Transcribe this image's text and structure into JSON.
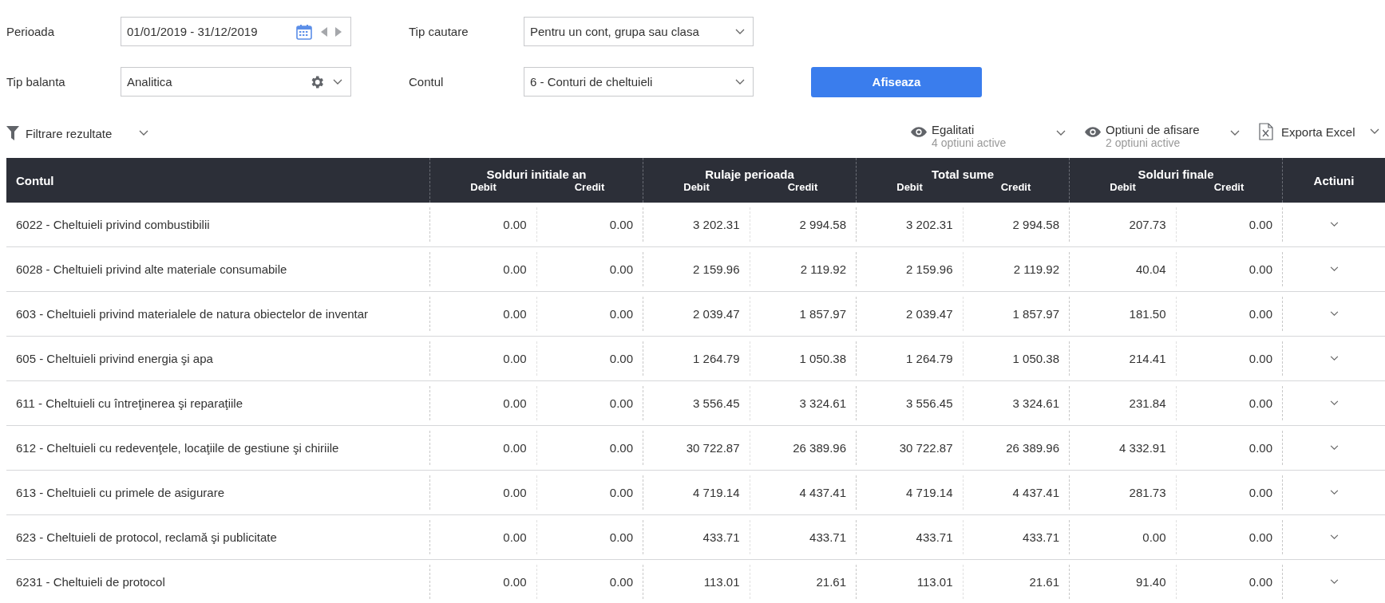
{
  "filters": [
    {
      "label": "Perioada",
      "kind": "date",
      "value": "01/01/2019 - 31/12/2019"
    },
    {
      "label": "Tip cautare",
      "kind": "select",
      "value": "Pentru un cont, grupa sau clasa"
    },
    {
      "label": "Tip balanta",
      "kind": "gear-select",
      "value": "Analitica"
    },
    {
      "label": "Contul",
      "kind": "select",
      "value": "6 - Conturi de cheltuieli"
    }
  ],
  "submit_button": "Afiseaza",
  "toolbar": {
    "filter": "Filtrare rezultate",
    "options": [
      {
        "label": "Egalitati",
        "sub": "4 optiuni active"
      },
      {
        "label": "Optiuni de afisare",
        "sub": "2 optiuni active"
      }
    ],
    "export": "Exporta Excel"
  },
  "table": {
    "first_column": "Contul",
    "groups": [
      {
        "title": "Solduri initiale an",
        "subs": [
          "Debit",
          "Credit"
        ]
      },
      {
        "title": "Rulaje perioada",
        "subs": [
          "Debit",
          "Credit"
        ]
      },
      {
        "title": "Total sume",
        "subs": [
          "Debit",
          "Credit"
        ]
      },
      {
        "title": "Solduri finale",
        "subs": [
          "Debit",
          "Credit"
        ]
      }
    ],
    "actions_column": "Actiuni",
    "rows": [
      {
        "account": "6022 - Cheltuieli privind combustibilii",
        "values": [
          "0.00",
          "0.00",
          "3 202.31",
          "2 994.58",
          "3 202.31",
          "2 994.58",
          "207.73",
          "0.00"
        ]
      },
      {
        "account": "6028 - Cheltuieli privind alte materiale consumabile",
        "values": [
          "0.00",
          "0.00",
          "2 159.96",
          "2 119.92",
          "2 159.96",
          "2 119.92",
          "40.04",
          "0.00"
        ]
      },
      {
        "account": "603 - Cheltuieli privind materialele de natura obiectelor de inventar",
        "values": [
          "0.00",
          "0.00",
          "2 039.47",
          "1 857.97",
          "2 039.47",
          "1 857.97",
          "181.50",
          "0.00"
        ]
      },
      {
        "account": "605 - Cheltuieli privind energia şi apa",
        "values": [
          "0.00",
          "0.00",
          "1 264.79",
          "1 050.38",
          "1 264.79",
          "1 050.38",
          "214.41",
          "0.00"
        ]
      },
      {
        "account": "611 - Cheltuieli cu întreţinerea şi reparaţiile",
        "values": [
          "0.00",
          "0.00",
          "3 556.45",
          "3 324.61",
          "3 556.45",
          "3 324.61",
          "231.84",
          "0.00"
        ]
      },
      {
        "account": "612 - Cheltuieli cu redevenţele, locaţiile de gestiune şi chiriile",
        "values": [
          "0.00",
          "0.00",
          "30 722.87",
          "26 389.96",
          "30 722.87",
          "26 389.96",
          "4 332.91",
          "0.00"
        ]
      },
      {
        "account": "613 - Cheltuieli cu primele de asigurare",
        "values": [
          "0.00",
          "0.00",
          "4 719.14",
          "4 437.41",
          "4 719.14",
          "4 437.41",
          "281.73",
          "0.00"
        ]
      },
      {
        "account": "623 - Cheltuieli de protocol, reclamă şi publicitate",
        "values": [
          "0.00",
          "0.00",
          "433.71",
          "433.71",
          "433.71",
          "433.71",
          "0.00",
          "0.00"
        ]
      },
      {
        "account": "6231 - Cheltuieli de protocol",
        "values": [
          "0.00",
          "0.00",
          "113.01",
          "21.61",
          "113.01",
          "21.61",
          "91.40",
          "0.00"
        ]
      }
    ]
  }
}
